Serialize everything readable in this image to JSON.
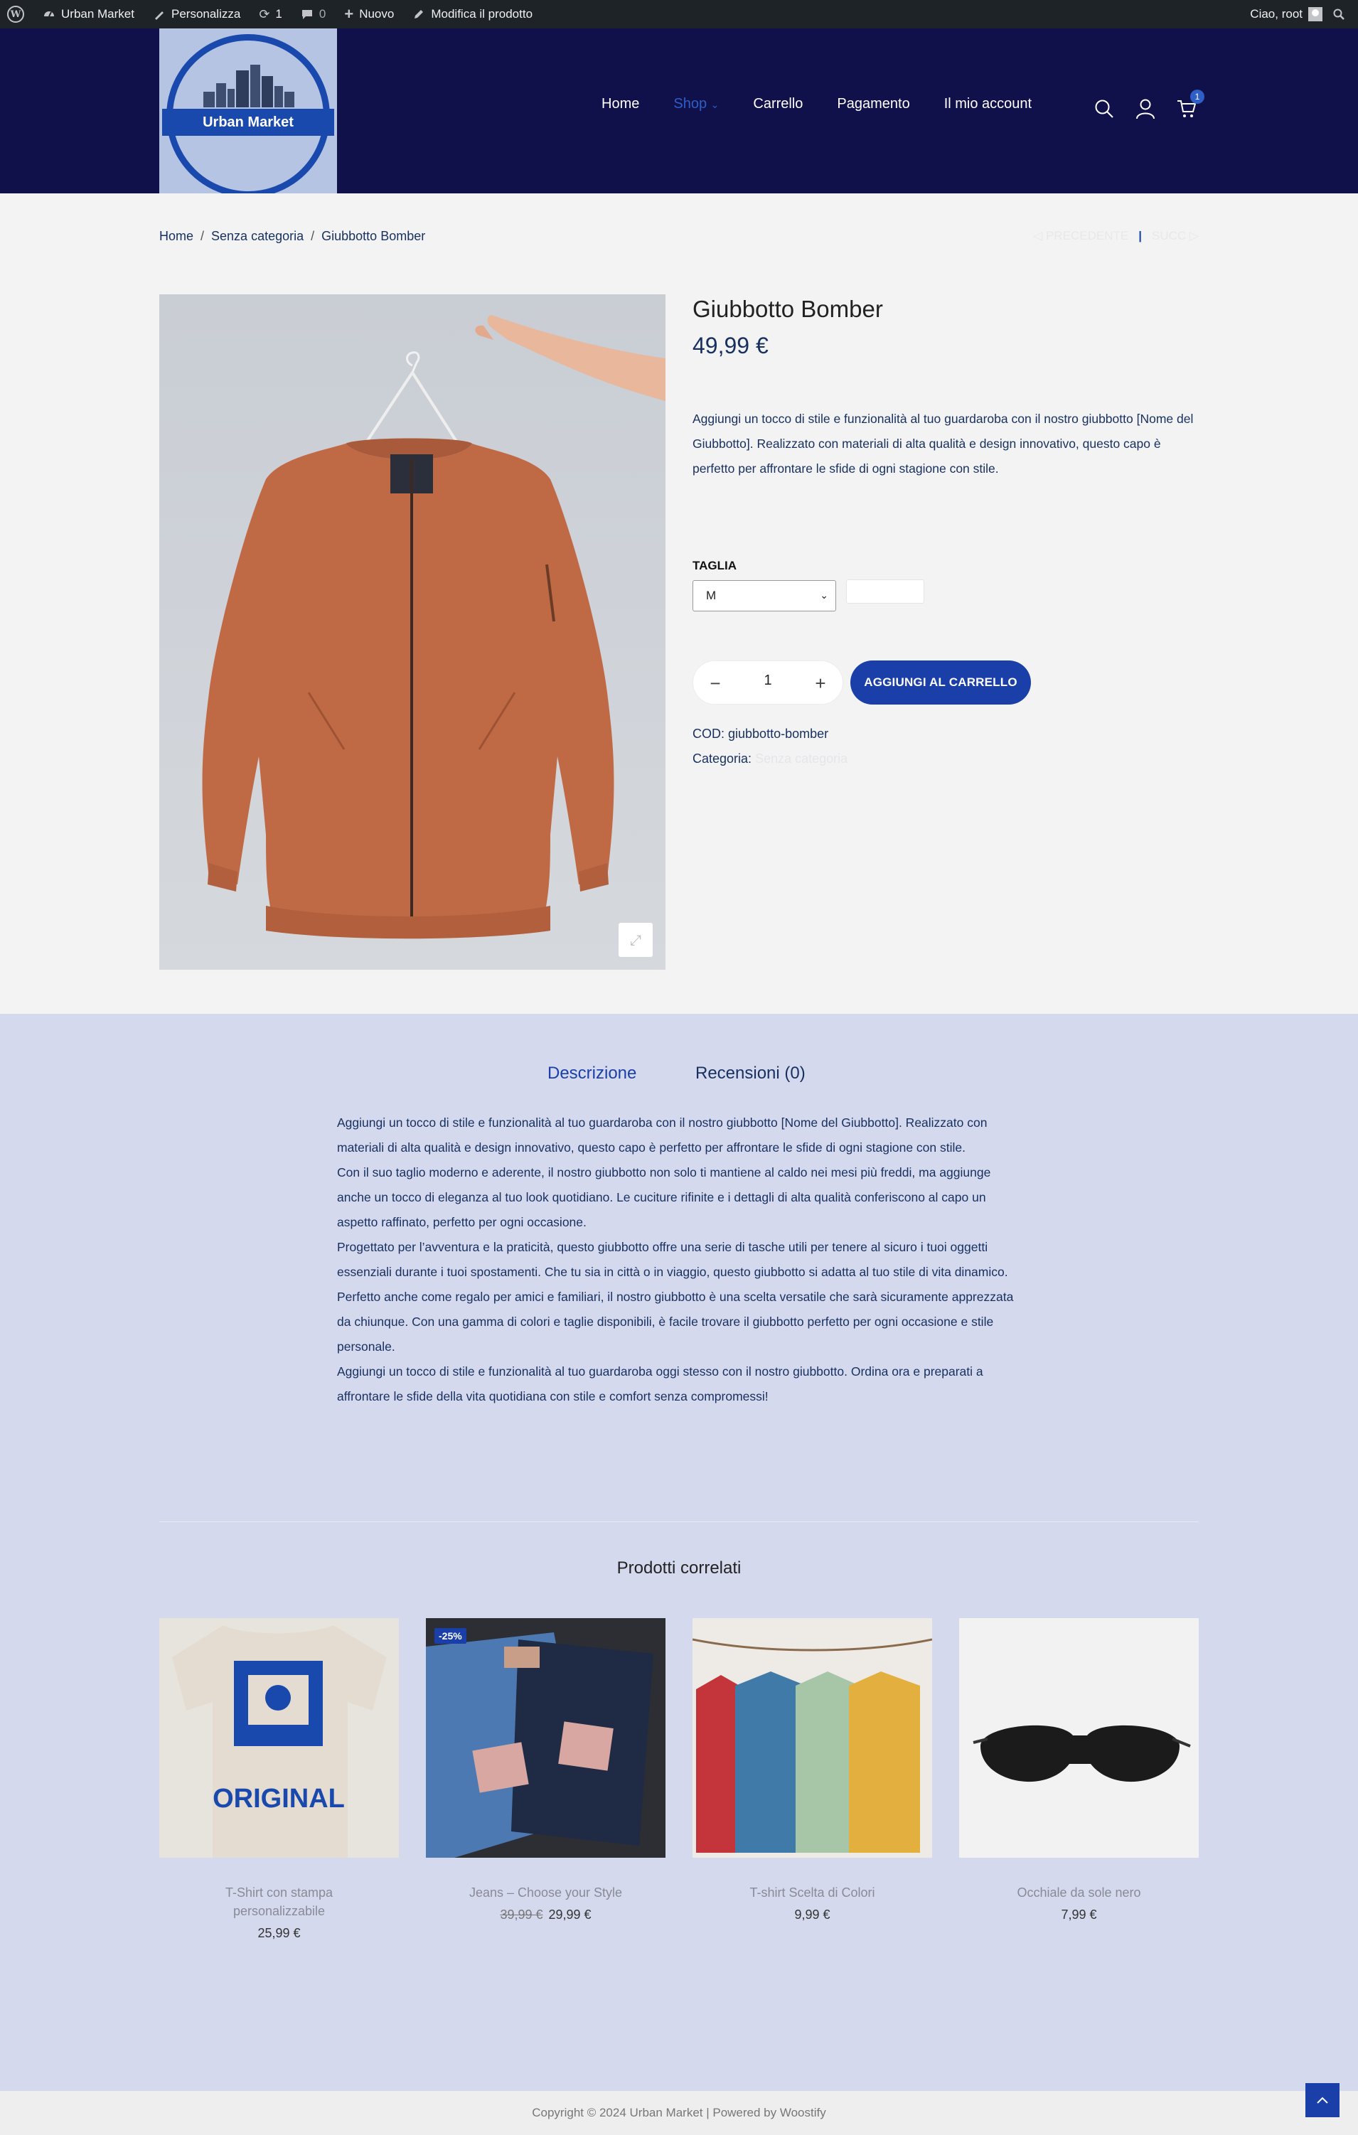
{
  "adminbar": {
    "site": "Urban Market",
    "customize": "Personalizza",
    "updates": "1",
    "comments": "0",
    "new": "Nuovo",
    "edit": "Modifica il prodotto",
    "greeting": "Ciao, root"
  },
  "header": {
    "logo_text": "Urban Market",
    "nav": [
      "Home",
      "Shop",
      "Carrello",
      "Pagamento",
      "Il mio account"
    ],
    "cart_count": "1"
  },
  "breadcrumb": [
    "Home",
    "Senza categoria",
    "Giubbotto Bomber"
  ],
  "prevnext": {
    "prev": "PRECEDENTE",
    "next": "SUCC"
  },
  "product": {
    "title": "Giubbotto Bomber",
    "price": "49,99 €",
    "short_desc": "Aggiungi un tocco di stile e funzionalità al tuo guardaroba con il nostro giubbotto [Nome del Giubbotto]. Realizzato con materiali di alta qualità e design innovativo, questo capo è perfetto per affrontare le sfide di ogni stagione con stile.",
    "size_label": "TAGLIA",
    "size_value": "M",
    "quantity": "1",
    "add_to_cart": "AGGIUNGI AL CARRELLO",
    "sku_label": "COD:",
    "sku": "giubbotto-bomber",
    "category_label": "Categoria:",
    "category": "Senza categoria"
  },
  "tabs": {
    "description": "Descrizione",
    "reviews": "Recensioni (0)"
  },
  "description_paragraphs": [
    "Aggiungi un tocco di stile e funzionalità al tuo guardaroba con il nostro giubbotto [Nome del Giubbotto]. Realizzato con materiali di alta qualità e design innovativo, questo capo è perfetto per affrontare le sfide di ogni stagione con stile.",
    "Con il suo taglio moderno e aderente, il nostro giubbotto non solo ti mantiene al caldo nei mesi più freddi, ma aggiunge anche un tocco di eleganza al tuo look quotidiano. Le cuciture rifinite e i dettagli di alta qualità conferiscono al capo un aspetto raffinato, perfetto per ogni occasione.",
    "Progettato per l’avventura e la praticità, questo giubbotto offre una serie di tasche utili per tenere al sicuro i tuoi oggetti essenziali durante i tuoi spostamenti. Che tu sia in città o in viaggio, questo giubbotto si adatta al tuo stile di vita dinamico.",
    "Perfetto anche come regalo per amici e familiari, il nostro giubbotto è una scelta versatile che sarà sicuramente apprezzata da chiunque. Con una gamma di colori e taglie disponibili, è facile trovare il giubbotto perfetto per ogni occasione e stile personale.",
    "Aggiungi un tocco di stile e funzionalità al tuo guardaroba oggi stesso con il nostro giubbotto. Ordina ora e preparati a affrontare le sfide della vita quotidiana con stile e comfort senza compromessi!"
  ],
  "related": {
    "title": "Prodotti correlati",
    "items": [
      {
        "name": "T-Shirt con stampa personalizzabile",
        "price": "25,99 €",
        "old_price": ""
      },
      {
        "name": "Jeans – Choose your Style",
        "price": "29,99 €",
        "old_price": "39,99 €",
        "badge": "-25%"
      },
      {
        "name": "T-shirt Scelta di Colori",
        "price": "9,99 €",
        "old_price": ""
      },
      {
        "name": "Occhiale da sole nero",
        "price": "7,99 €",
        "old_price": ""
      }
    ]
  },
  "footer": {
    "text": "Copyright © 2024 Urban Market | Powered by Woostify"
  },
  "colors": {
    "header_bg": "#10104a",
    "accent": "#1a3fa9",
    "tab_section_bg": "#d5d9ee"
  }
}
